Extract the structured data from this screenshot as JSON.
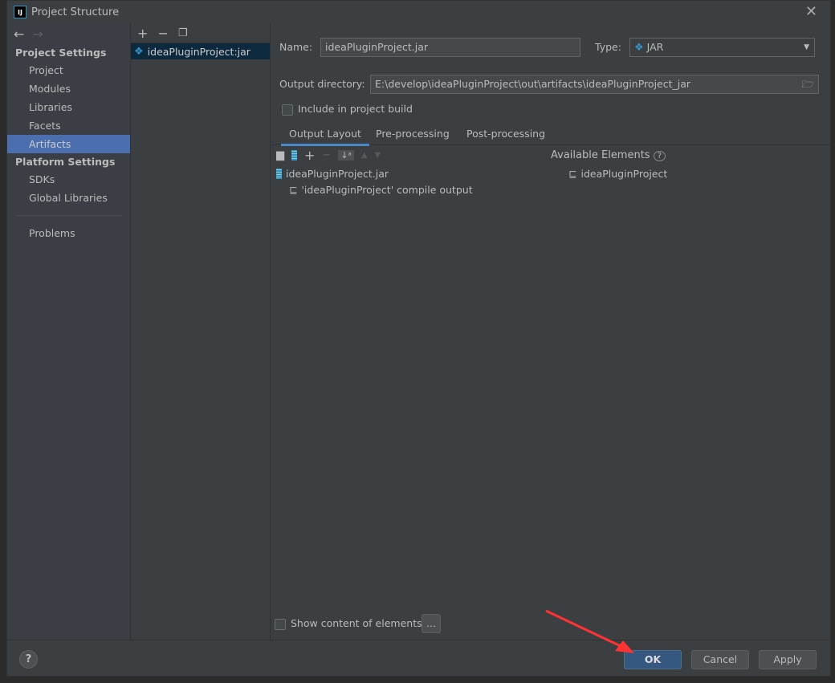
{
  "window": {
    "title": "Project Structure",
    "logo": "IJ"
  },
  "sidebar": {
    "project_settings": "Project Settings",
    "items": [
      "Project",
      "Modules",
      "Libraries",
      "Facets",
      "Artifacts"
    ],
    "platform_settings": "Platform Settings",
    "platform_items": [
      "SDKs",
      "Global Libraries"
    ],
    "problems": "Problems",
    "selected": "Artifacts"
  },
  "artifacts": {
    "list": [
      "ideaPluginProject:jar"
    ]
  },
  "form": {
    "name_label": "Name:",
    "name_value": "ideaPluginProject.jar",
    "type_label": "Type:",
    "type_value": "JAR",
    "output_label": "Output directory:",
    "output_value": "E:\\develop\\ideaPluginProject\\out\\artifacts\\ideaPluginProject_jar",
    "include_label": "Include in project build"
  },
  "tabs": [
    "Output Layout",
    "Pre-processing",
    "Post-processing"
  ],
  "layout": {
    "available_label": "Available Elements",
    "tree_root": "ideaPluginProject.jar",
    "tree_child": "'ideaPluginProject' compile output",
    "available_item": "ideaPluginProject",
    "show_content_label": "Show content of elements",
    "more_btn": "..."
  },
  "buttons": {
    "help": "?",
    "ok": "OK",
    "cancel": "Cancel",
    "apply": "Apply"
  },
  "colors": {
    "accent": "#4b6eaf",
    "ok": "#365880",
    "annotation_arrow": "#ff3333"
  }
}
